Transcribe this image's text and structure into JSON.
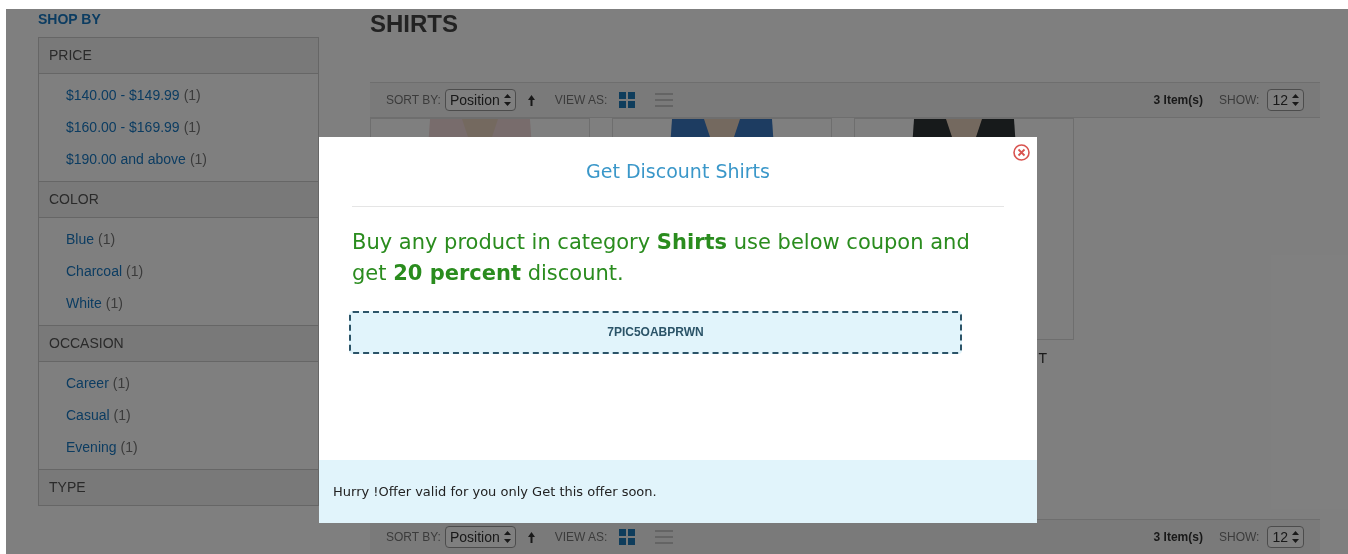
{
  "sidebar": {
    "title": "SHOP BY",
    "sections": [
      {
        "title": "PRICE",
        "items": [
          {
            "label": "$140.00 - $149.99",
            "count": "(1)"
          },
          {
            "label": "$160.00 - $169.99",
            "count": "(1)"
          },
          {
            "label": "$190.00 and above",
            "count": "(1)"
          }
        ]
      },
      {
        "title": "COLOR",
        "items": [
          {
            "label": "Blue",
            "count": "(1)"
          },
          {
            "label": "Charcoal",
            "count": "(1)"
          },
          {
            "label": "White",
            "count": "(1)"
          }
        ]
      },
      {
        "title": "OCCASION",
        "items": [
          {
            "label": "Career",
            "count": "(1)"
          },
          {
            "label": "Casual",
            "count": "(1)"
          },
          {
            "label": "Evening",
            "count": "(1)"
          }
        ]
      },
      {
        "title": "TYPE"
      }
    ]
  },
  "category": {
    "title": "SHIRTS"
  },
  "toolbars": [
    {
      "sort_label": "SORT BY:",
      "sort_value": "Position",
      "view_label": "VIEW AS:",
      "view_modes": [
        {
          "kind": "grid",
          "selected": true
        },
        {
          "kind": "list",
          "selected": false
        }
      ],
      "count": "3 Item(s)",
      "show_label": "SHOW:",
      "show_value": "12"
    },
    {
      "sort_label": "SORT BY:",
      "sort_value": "Position",
      "view_label": "VIEW AS:",
      "view_modes": [
        {
          "kind": "grid",
          "selected": true
        },
        {
          "kind": "list",
          "selected": false
        }
      ],
      "count": "3 Item(s)",
      "show_label": "SHOW:",
      "show_value": "12"
    }
  ],
  "products": [
    {
      "kind": "picture"
    },
    {
      "kind": "picture"
    },
    {
      "kind": "picture",
      "name": "T"
    }
  ],
  "modal": {
    "title": "Get Discount Shirts",
    "message": "Buy any product in category **Shirts** use below coupon and get **20 percent** discount.",
    "coupon": "7PIC5OABPRWN",
    "footer": "Hurry !Offer valid for you only Get this offer soon."
  }
}
